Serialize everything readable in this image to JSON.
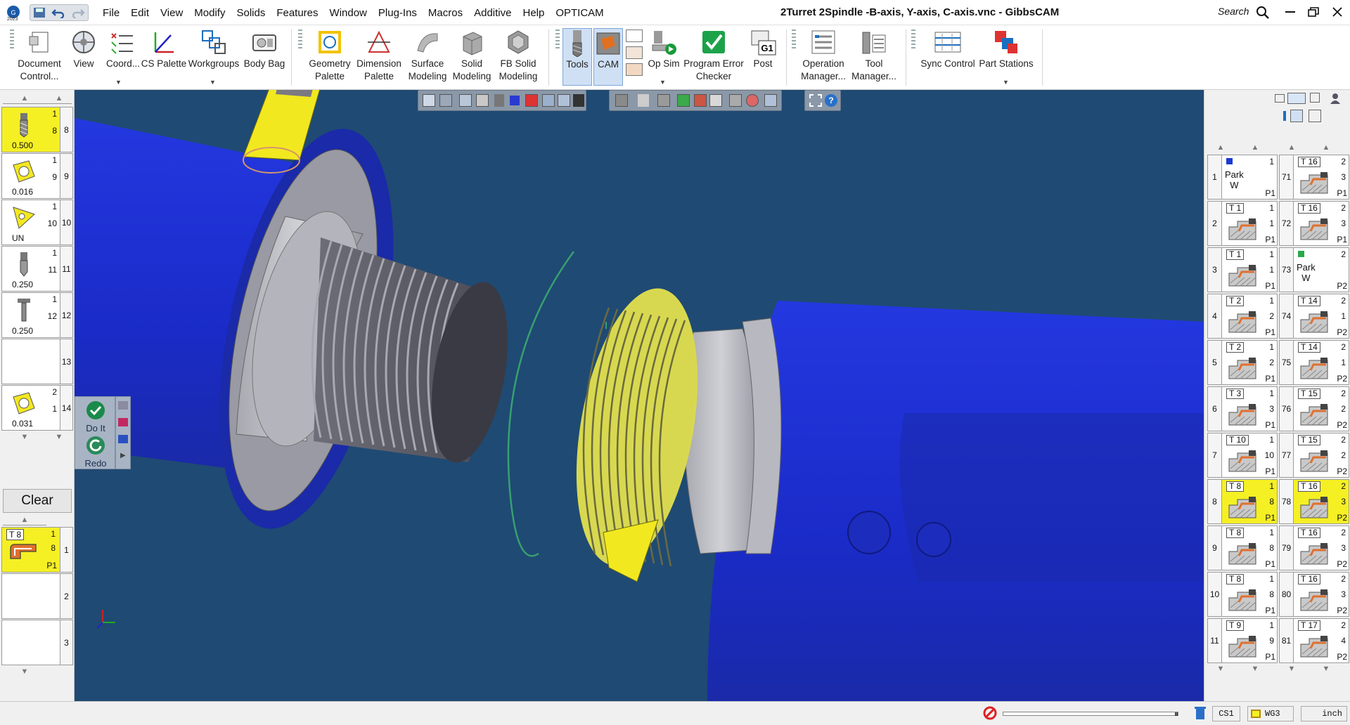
{
  "titlebar": {
    "title": "2Turret 2Spindle -B-axis, Y-axis, C-axis.vnc - GibbsCAM",
    "search": "Search",
    "logo_year": "2023",
    "menu": [
      "File",
      "Edit",
      "View",
      "Modify",
      "Solids",
      "Features",
      "Window",
      "Plug-Ins",
      "Macros",
      "Additive",
      "Help",
      "OPTICAM"
    ]
  },
  "ribbon": {
    "buttons": [
      {
        "l1": "Document",
        "l2": "Control..."
      },
      {
        "l1": "View",
        "l2": ""
      },
      {
        "l1": "Coord...",
        "l2": ""
      },
      {
        "l1": "CS Palette",
        "l2": ""
      },
      {
        "l1": "Workgroups",
        "l2": ""
      },
      {
        "l1": "Body Bag",
        "l2": ""
      },
      {
        "l1": "Geometry",
        "l2": "Palette"
      },
      {
        "l1": "Dimension",
        "l2": "Palette"
      },
      {
        "l1": "Surface",
        "l2": "Modeling"
      },
      {
        "l1": "Solid",
        "l2": "Modeling"
      },
      {
        "l1": "FB Solid",
        "l2": "Modeling"
      },
      {
        "l1": "Tools",
        "l2": ""
      },
      {
        "l1": "CAM",
        "l2": ""
      },
      {
        "l1": "Op Sim",
        "l2": ""
      },
      {
        "l1": "Program Error",
        "l2": "Checker"
      },
      {
        "l1": "Post",
        "l2": ""
      },
      {
        "l1": "Operation",
        "l2": "Manager..."
      },
      {
        "l1": "Tool",
        "l2": "Manager..."
      },
      {
        "l1": "Sync Control",
        "l2": ""
      },
      {
        "l1": "Part Stations",
        "l2": ""
      }
    ]
  },
  "tools": [
    {
      "n": "1",
      "s": "8",
      "side": "8",
      "val": "0.500",
      "sel": true
    },
    {
      "n": "1",
      "s": "9",
      "side": "9",
      "val": "0.016",
      "sel": false
    },
    {
      "n": "1",
      "s": "10",
      "side": "10",
      "val": "UN",
      "sel": false
    },
    {
      "n": "1",
      "s": "11",
      "side": "11",
      "val": "0.250",
      "sel": false
    },
    {
      "n": "1",
      "s": "12",
      "side": "12",
      "val": "0.250",
      "sel": false
    },
    {
      "n": "",
      "s": "",
      "side": "13",
      "val": "",
      "sel": false
    },
    {
      "n": "2",
      "s": "1",
      "side": "14",
      "val": "0.031",
      "sel": false
    }
  ],
  "process": {
    "clear": "Clear",
    "doit": "Do It",
    "redo": "Redo",
    "tile": {
      "tool": "T 8",
      "n": "1",
      "s": "8",
      "p": "P1",
      "side": "1"
    },
    "side2": "2",
    "side3": "3"
  },
  "ops_left": [
    {
      "idx": "1",
      "tool": "",
      "tr": "1",
      "mr": "",
      "br": "P1",
      "park": "Park\nW",
      "sel": false
    },
    {
      "idx": "2",
      "tool": "T 1",
      "tr": "1",
      "mr": "1",
      "br": "P1",
      "sel": false
    },
    {
      "idx": "3",
      "tool": "T 1",
      "tr": "1",
      "mr": "1",
      "br": "P1",
      "sel": false
    },
    {
      "idx": "4",
      "tool": "T 2",
      "tr": "1",
      "mr": "2",
      "br": "P1",
      "sel": false
    },
    {
      "idx": "5",
      "tool": "T 2",
      "tr": "1",
      "mr": "2",
      "br": "P1",
      "sel": false
    },
    {
      "idx": "6",
      "tool": "T 3",
      "tr": "1",
      "mr": "3",
      "br": "P1",
      "sel": false
    },
    {
      "idx": "7",
      "tool": "T 10",
      "tr": "1",
      "mr": "10",
      "br": "P1",
      "sel": false
    },
    {
      "idx": "8",
      "tool": "T 8",
      "tr": "1",
      "mr": "8",
      "br": "P1",
      "sel": true
    },
    {
      "idx": "9",
      "tool": "T 8",
      "tr": "1",
      "mr": "8",
      "br": "P1",
      "sel": false
    },
    {
      "idx": "10",
      "tool": "T 8",
      "tr": "1",
      "mr": "8",
      "br": "P1",
      "sel": false
    },
    {
      "idx": "11",
      "tool": "T 9",
      "tr": "1",
      "mr": "9",
      "br": "P1",
      "sel": false
    }
  ],
  "ops_right": [
    {
      "idx": "71",
      "tool": "T 16",
      "tr": "2",
      "mr": "3",
      "br": "P1",
      "sel": false
    },
    {
      "idx": "72",
      "tool": "T 16",
      "tr": "2",
      "mr": "3",
      "br": "P1",
      "sel": false
    },
    {
      "idx": "73",
      "tool": "",
      "tr": "2",
      "mr": "",
      "br": "P2",
      "park": "Park\nW",
      "sel": false
    },
    {
      "idx": "74",
      "tool": "T 14",
      "tr": "2",
      "mr": "1",
      "br": "P2",
      "sel": false
    },
    {
      "idx": "75",
      "tool": "T 14",
      "tr": "2",
      "mr": "1",
      "br": "P2",
      "sel": false
    },
    {
      "idx": "76",
      "tool": "T 15",
      "tr": "2",
      "mr": "2",
      "br": "P2",
      "sel": false
    },
    {
      "idx": "77",
      "tool": "T 15",
      "tr": "2",
      "mr": "2",
      "br": "P2",
      "sel": false
    },
    {
      "idx": "78",
      "tool": "T 16",
      "tr": "2",
      "mr": "3",
      "br": "P2",
      "sel": true
    },
    {
      "idx": "79",
      "tool": "T 16",
      "tr": "2",
      "mr": "3",
      "br": "P2",
      "sel": false
    },
    {
      "idx": "80",
      "tool": "T 16",
      "tr": "2",
      "mr": "3",
      "br": "P2",
      "sel": false
    },
    {
      "idx": "81",
      "tool": "T 17",
      "tr": "2",
      "mr": "4",
      "br": "P2",
      "sel": false
    }
  ],
  "status": {
    "cs": "CS1",
    "wg": "WG3",
    "units": "inch"
  },
  "colors": {
    "accent": "#f5f024",
    "viewport": "#1f4a73",
    "part_blue": "#1c2ecc",
    "thread_gray": "#8c8c96"
  }
}
